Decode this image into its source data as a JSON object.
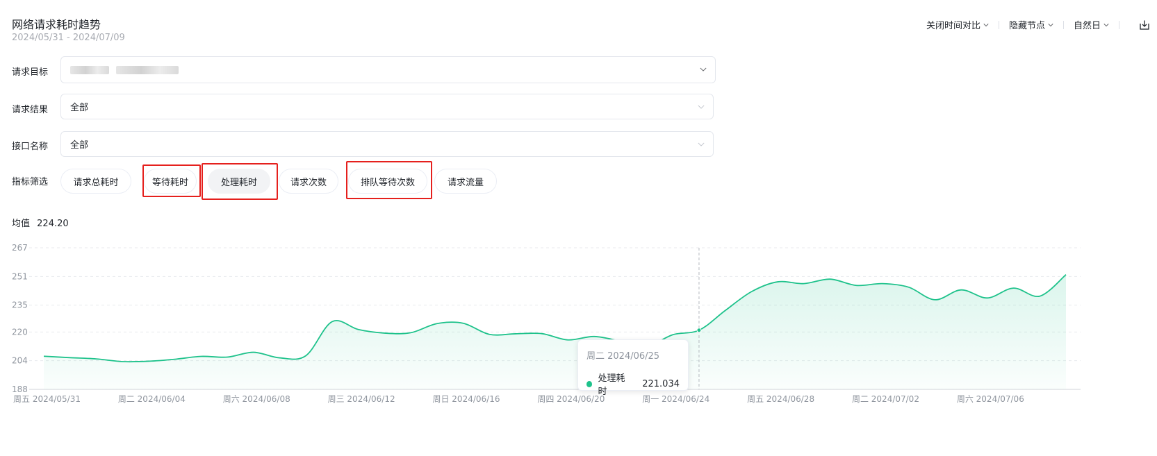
{
  "header": {
    "title": "网络请求耗时趋势",
    "date_range": "2024/05/31 - 2024/07/09"
  },
  "toolbar": {
    "compare": "关闭时间对比",
    "hide_nodes": "隐藏节点",
    "period": "自然日",
    "export_icon": "export-icon"
  },
  "filters": {
    "target": {
      "label": "请求目标",
      "value": ""
    },
    "result": {
      "label": "请求结果",
      "value": "全部"
    },
    "api": {
      "label": "接口名称",
      "value": "全部"
    },
    "metric": {
      "label": "指标筛选",
      "options": [
        "请求总耗时",
        "等待耗时",
        "处理耗时",
        "请求次数",
        "排队等待次数",
        "请求流量"
      ],
      "selected": "处理耗时"
    }
  },
  "summary": {
    "avg_label": "均值",
    "avg_value": "224.20"
  },
  "colors": {
    "accent": "#1ec28b",
    "highlight_box": "#e5201d",
    "grid": "#e8eaed"
  },
  "chart_data": {
    "type": "area",
    "y_ticks": [
      188,
      204,
      220,
      235,
      251,
      267
    ],
    "ylim": [
      188,
      267
    ],
    "x_tick_labels": [
      "周五 2024/05/31",
      "周二 2024/06/04",
      "周六 2024/06/08",
      "周三 2024/06/12",
      "周日 2024/06/16",
      "周四 2024/06/20",
      "周一 2024/06/24",
      "周五 2024/06/28",
      "周二 2024/07/02",
      "周六 2024/07/06"
    ],
    "grid": true,
    "series": [
      {
        "name": "处理耗时",
        "x": [
          "2024/05/31",
          "2024/06/01",
          "2024/06/02",
          "2024/06/03",
          "2024/06/04",
          "2024/06/05",
          "2024/06/06",
          "2024/06/07",
          "2024/06/08",
          "2024/06/09",
          "2024/06/10",
          "2024/06/11",
          "2024/06/12",
          "2024/06/13",
          "2024/06/14",
          "2024/06/15",
          "2024/06/16",
          "2024/06/17",
          "2024/06/18",
          "2024/06/19",
          "2024/06/20",
          "2024/06/21",
          "2024/06/22",
          "2024/06/23",
          "2024/06/24",
          "2024/06/25",
          "2024/06/26",
          "2024/06/27",
          "2024/06/28",
          "2024/06/29",
          "2024/06/30",
          "2024/07/01",
          "2024/07/02",
          "2024/07/03",
          "2024/07/04",
          "2024/07/05",
          "2024/07/06",
          "2024/07/07",
          "2024/07/08",
          "2024/07/09"
        ],
        "values": [
          206.5,
          205.7,
          205.0,
          203.5,
          203.7,
          204.8,
          206.4,
          206.0,
          208.7,
          205.6,
          206.8,
          225.8,
          221.4,
          219.4,
          219.6,
          224.7,
          224.9,
          218.7,
          219.0,
          219.1,
          215.6,
          217.5,
          214.9,
          212.0,
          218.5,
          221.0,
          232.0,
          242.5,
          248.0,
          247.0,
          249.5,
          246.0,
          247.0,
          245.0,
          238.0,
          243.5,
          239.0,
          244.5,
          240.0,
          252.0
        ]
      }
    ],
    "tooltip": {
      "date": "周二 2024/06/25",
      "series": "处理耗时",
      "value": "221.034"
    }
  }
}
